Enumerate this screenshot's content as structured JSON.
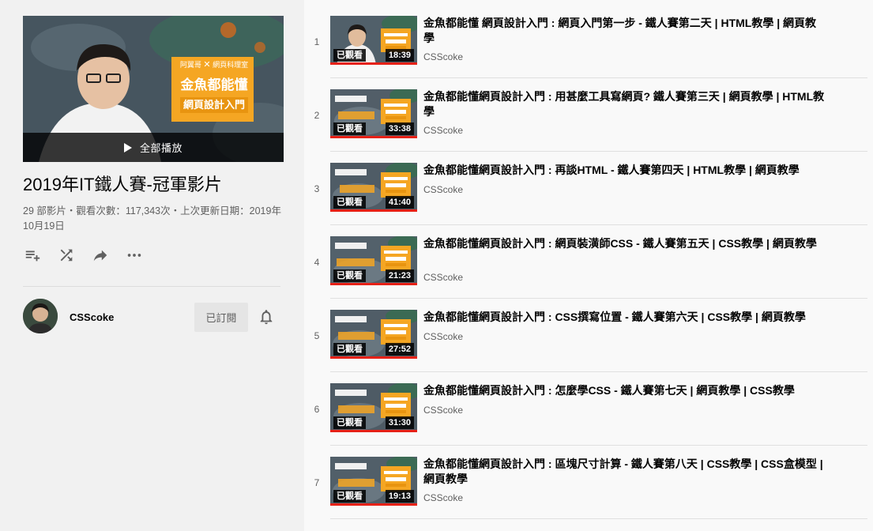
{
  "playlist": {
    "play_all_label": "全部播放",
    "hero_text": {
      "line1_left": "阿翼哥",
      "line1_right": "網頁科理室",
      "line2": "金魚都能懂",
      "line3": "網頁設計入門"
    },
    "title": "2019年IT鐵人賽-冠軍影片",
    "stats": "29 部影片・觀看次數：117,343次・上次更新日期：2019年10月19日",
    "actions": [
      {
        "name": "save-to-queue-icon"
      },
      {
        "name": "shuffle-icon"
      },
      {
        "name": "share-icon"
      },
      {
        "name": "more-icon"
      }
    ],
    "owner": {
      "name": "CSScoke",
      "subscribe_label": "已訂閱"
    }
  },
  "videos": [
    {
      "index": "1",
      "title": "金魚都能懂 網頁設計入門 : 網頁入門第一步 - 鐵人賽第二天 | HTML教學 | 網頁教學",
      "channel": "CSScoke",
      "badge": "已觀看",
      "duration": "18:39"
    },
    {
      "index": "2",
      "title": "金魚都能懂網頁設計入門 : 用甚麼工具寫網頁? 鐵人賽第三天 | 網頁教學 | HTML教學",
      "channel": "CSScoke",
      "badge": "已觀看",
      "duration": "33:38"
    },
    {
      "index": "3",
      "title": "金魚都能懂網頁設計入門 : 再談HTML - 鐵人賽第四天 | HTML教學 | 網頁教學",
      "channel": "CSScoke",
      "badge": "已觀看",
      "duration": "41:40"
    },
    {
      "index": "4",
      "title": "金魚都能懂網頁設計入門 : 網頁裝潢師CSS - 鐵人賽第五天 | CSS教學 | 網頁教學",
      "channel": "CSScoke",
      "badge": "已觀看",
      "duration": "21:23"
    },
    {
      "index": "5",
      "title": "金魚都能懂網頁設計入門 : CSS撰寫位置 - 鐵人賽第六天 | CSS教學 | 網頁教學",
      "channel": "CSScoke",
      "badge": "已觀看",
      "duration": "27:52"
    },
    {
      "index": "6",
      "title": "金魚都能懂網頁設計入門 : 怎麼學CSS - 鐵人賽第七天 | 網頁教學 | CSS教學",
      "channel": "CSScoke",
      "badge": "已觀看",
      "duration": "31:30"
    },
    {
      "index": "7",
      "title": "金魚都能懂網頁設計入門 : 區塊尺寸計算 - 鐵人賽第八天 | CSS教學 | CSS盒模型 | 網頁教學",
      "channel": "CSScoke",
      "badge": "已觀看",
      "duration": "19:13"
    }
  ],
  "colors": {
    "sidebar_bg": "#f1f1f1",
    "page_bg": "#f9f9f9",
    "progress_red": "#e62117",
    "hero_orange": "#f5a623"
  }
}
